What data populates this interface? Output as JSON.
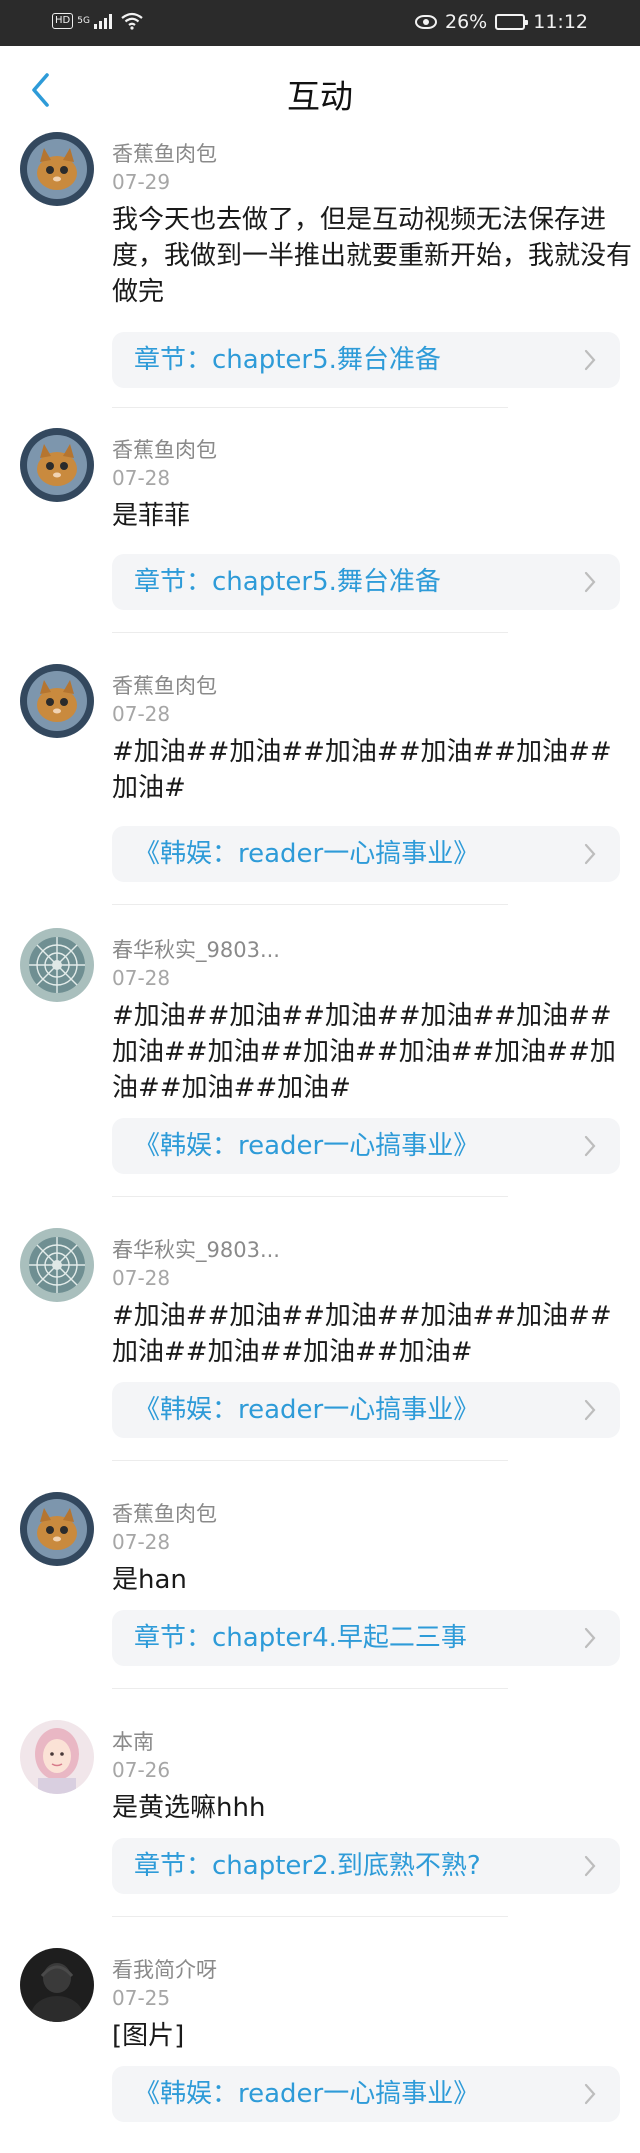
{
  "status_bar": {
    "hd": "HD",
    "network": "5G",
    "battery": "26%",
    "battery_level": 0.26,
    "time": "11:12"
  },
  "header": {
    "title": "互动"
  },
  "comments": [
    {
      "username": "香蕉鱼肉包",
      "date": "07-29",
      "text": "我今天也去做了，但是互动视频无法保存进度，我做到一半推出就要重新开始，我就没有做完",
      "link": "章节：chapter5.舞台准备",
      "avatar": "cat-avatar"
    },
    {
      "username": "香蕉鱼肉包",
      "date": "07-28",
      "text": "是菲菲",
      "link": "章节：chapter5.舞台准备",
      "avatar": "cat-avatar"
    },
    {
      "username": "香蕉鱼肉包",
      "date": "07-28",
      "text": "#加油##加油##加油##加油##加油##加油#",
      "link": "《韩娱：reader一心搞事业》",
      "avatar": "cat-avatar"
    },
    {
      "username": "春华秋实_9803...",
      "date": "07-28",
      "text": "#加油##加油##加油##加油##加油##加油##加油##加油##加油##加油##加油##加油##加油#",
      "link": "《韩娱：reader一心搞事业》",
      "avatar": "dome-avatar"
    },
    {
      "username": "春华秋实_9803...",
      "date": "07-28",
      "text": "#加油##加油##加油##加油##加油##加油##加油##加油##加油#",
      "link": "《韩娱：reader一心搞事业》",
      "avatar": "dome-avatar"
    },
    {
      "username": "香蕉鱼肉包",
      "date": "07-28",
      "text": "是han",
      "link": "章节：chapter4.早起二三事",
      "avatar": "cat-avatar"
    },
    {
      "username": "本南",
      "date": "07-26",
      "text": "是黄选嘛hhh",
      "link": "章节：chapter2.到底熟不熟?",
      "avatar": "girl-avatar"
    },
    {
      "username": "看我简介呀",
      "date": "07-25",
      "text": "[图片]",
      "link": "《韩娱：reader一心搞事业》",
      "avatar": "dark-avatar"
    }
  ],
  "colors": {
    "accent": "#2e9bd8",
    "statusbar": "#2b2b2b"
  }
}
